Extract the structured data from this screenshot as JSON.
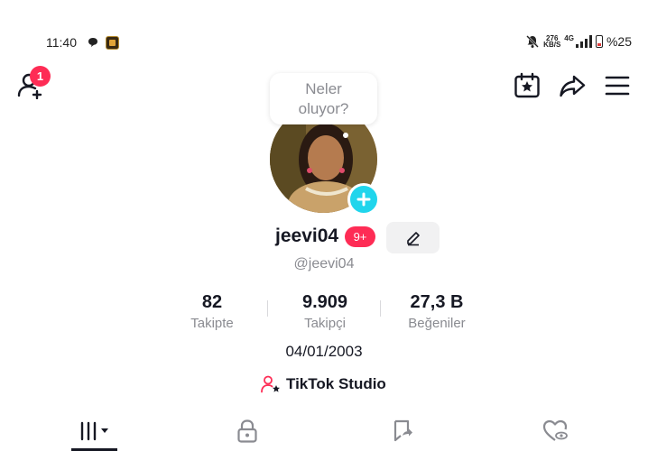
{
  "status_bar": {
    "time": "11:40",
    "speed_value": "276",
    "speed_unit": "KB/S",
    "network": "4G",
    "battery": "%25"
  },
  "header": {
    "notification_count": "1"
  },
  "profile": {
    "tooltip": "Neler oluyor?",
    "username": "jeevi04",
    "badge": "9+",
    "handle": "@jeevi04",
    "bio": "04/01/2003",
    "studio_label": "TikTok Studio"
  },
  "stats": [
    {
      "value": "82",
      "label": "Takipte"
    },
    {
      "value": "9.909",
      "label": "Takipçi"
    },
    {
      "value": "27,3 B",
      "label": "Beğeniler"
    }
  ],
  "tabs": [
    "videos",
    "private",
    "reposts",
    "liked"
  ],
  "colors": {
    "accent": "#fe2c55",
    "add_button": "#20d5ec",
    "text_primary": "#161823",
    "text_secondary": "#8a8b91"
  }
}
